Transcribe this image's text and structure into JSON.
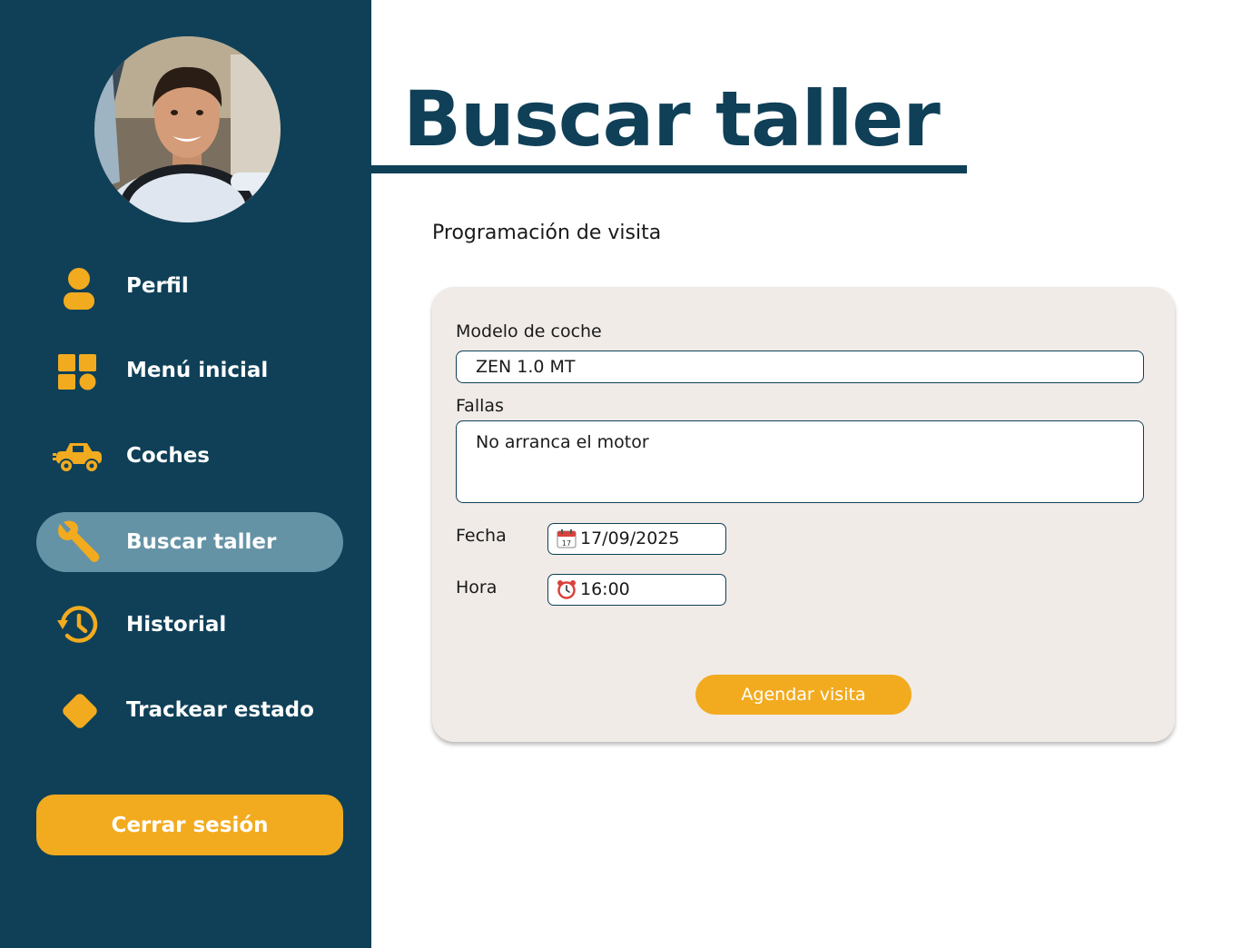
{
  "sidebar": {
    "avatar_alt": "",
    "items": [
      {
        "label": "Perfil",
        "icon": "user-icon"
      },
      {
        "label": "Menú inicial",
        "icon": "dashboard-icon"
      },
      {
        "label": "Coches",
        "icon": "car-icon"
      },
      {
        "label": "Buscar taller",
        "icon": "wrench-icon",
        "active": true
      },
      {
        "label": "Historial",
        "icon": "history-icon"
      },
      {
        "label": "Trackear estado",
        "icon": "diamond-icon"
      }
    ],
    "logout_label": "Cerrar sesión"
  },
  "header": {
    "title": "Buscar taller"
  },
  "main": {
    "section_heading": "Programación de visita",
    "form": {
      "car_model_label": "Modelo de coche",
      "car_model_value": "ZEN 1.0 MT",
      "faults_label": "Fallas",
      "faults_value": "No arranca el motor",
      "date_label": "Fecha",
      "date_value": "17/09/2025",
      "date_icon": "calendar-icon",
      "time_label": "Hora",
      "time_value": "16:00",
      "time_icon": "alarm-clock-icon",
      "submit_label": "Agendar visita"
    }
  },
  "colors": {
    "sidebar_bg": "#0f4058",
    "accent": "#f2ab1f",
    "active_item_bg": "#6593a6",
    "card_bg": "#f0ebe7",
    "title_color": "#0f4058"
  }
}
